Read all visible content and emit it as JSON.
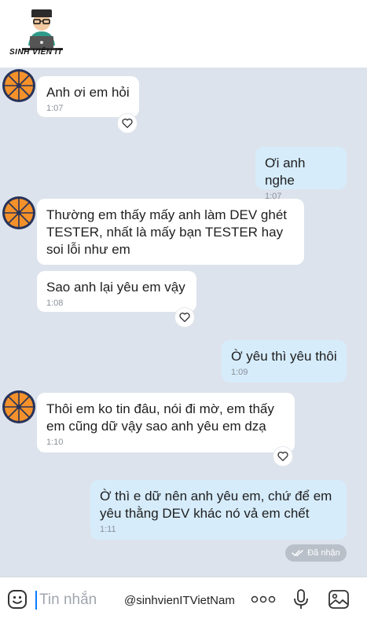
{
  "brand": {
    "logo_text": "SINH VIÊN IT"
  },
  "messages": [
    {
      "side": "in",
      "text": "Anh ơi em hỏi",
      "time": "1:07"
    },
    {
      "side": "out",
      "text": "Ơi anh nghe",
      "time": "1:07"
    },
    {
      "side": "in",
      "text": "Thường em thấy mấy anh làm DEV ghét\nTESTER, nhất là mấy bạn TESTER hay\nsoi lỗi như em",
      "time": ""
    },
    {
      "side": "in",
      "text": "Sao anh lại yêu em vậy",
      "time": "1:08"
    },
    {
      "side": "out",
      "text": "Ờ yêu thì yêu thôi",
      "time": "1:09"
    },
    {
      "side": "in",
      "text": "Thôi em ko tin đâu, nói đi mờ, em thấy\nem cũng dữ vậy sao anh yêu em dzạ",
      "time": "1:10"
    },
    {
      "side": "out",
      "text": "Ờ thì e dữ nên anh yêu em, chứ để em\nyêu thằng DEV khác nó vả em chết",
      "time": "1:11"
    }
  ],
  "status": {
    "label": "Đã nhận"
  },
  "composer": {
    "placeholder": "Tin nhắn",
    "watermark": "@sinhvienITVietNam"
  },
  "icons": {
    "emoji": "emoji-icon",
    "more": "more-icon",
    "mic": "microphone-icon",
    "image": "image-icon",
    "heart": "heart-icon",
    "check": "double-check-icon"
  },
  "colors": {
    "chat_bg": "#dde3ec",
    "incoming_bubble": "#ffffff",
    "outgoing_bubble": "#d6ecfb",
    "time_text": "#8a9099",
    "caret": "#0a7cff",
    "avatar_orange": "#f4912a",
    "avatar_ring": "#27335a"
  }
}
